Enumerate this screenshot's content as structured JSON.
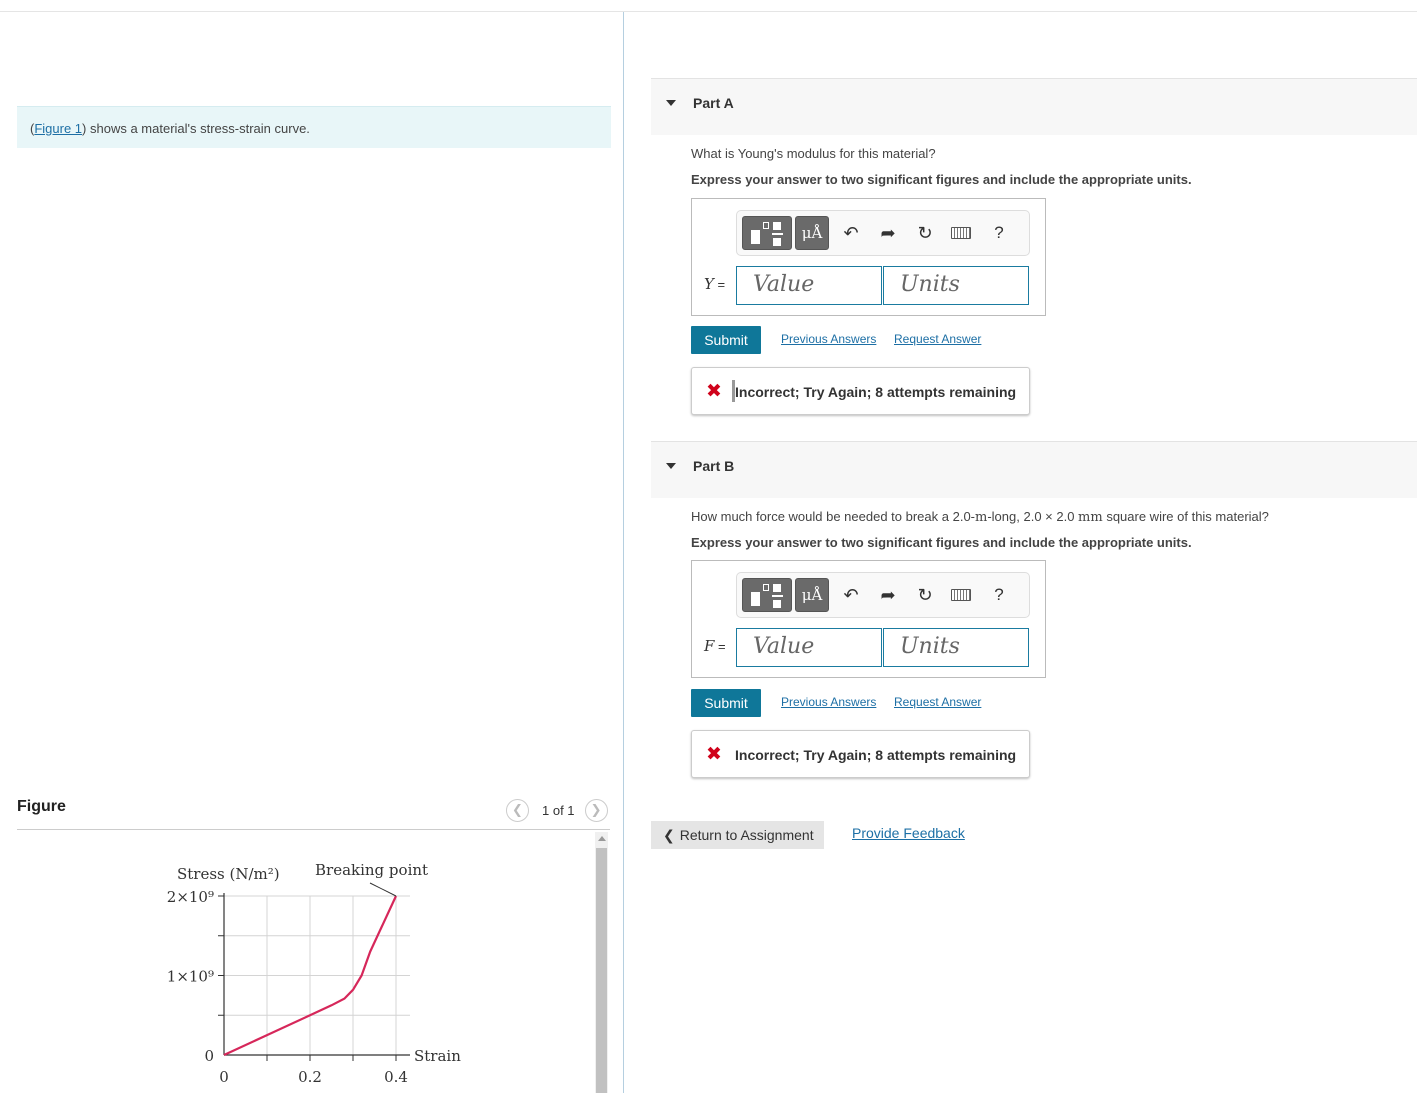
{
  "intro": {
    "paren_open": "(",
    "figure_link": "Figure 1",
    "text": ") shows a material's stress-strain curve."
  },
  "figure": {
    "title": "Figure",
    "pager_text": "1 of 1",
    "prev_icon": "chevron-left-icon",
    "next_icon": "chevron-right-icon"
  },
  "chart_data": {
    "type": "line",
    "title": "",
    "xlabel": "Strain",
    "ylabel": "Stress (N/m²)",
    "annotation": "Breaking point",
    "x_ticks": [
      "0",
      "0.2",
      "0.4"
    ],
    "y_ticks": [
      "0",
      "1×10⁹",
      "2×10⁹"
    ],
    "xlim": [
      0,
      0.4
    ],
    "ylim": [
      0,
      2000000000
    ],
    "grid": true,
    "series": [
      {
        "color": "#d6275a",
        "x": [
          0,
          0.1,
          0.2,
          0.25,
          0.28,
          0.3,
          0.32,
          0.34,
          0.37,
          0.4
        ],
        "y": [
          0,
          250000000,
          500000000,
          625000000,
          710000000,
          820000000,
          1000000000,
          1300000000,
          1650000000,
          2000000000
        ]
      }
    ]
  },
  "partA": {
    "title": "Part A",
    "question": "What is Young's modulus for this material?",
    "instruction": "Express your answer to two significant figures and include the appropriate units.",
    "variable": "Y",
    "equals": " =",
    "value_placeholder": "Value",
    "units_placeholder": "Units",
    "submit": "Submit",
    "previous_answers": "Previous Answers",
    "request_answer": "Request Answer",
    "feedback": "Incorrect; Try Again; 8 attempts remaining"
  },
  "partB": {
    "title": "Part B",
    "question_pre": "How much force would be needed to break a 2.0-",
    "question_unit1": "m",
    "question_mid": "-long, 2.0 × 2.0 ",
    "question_unit2": "mm",
    "question_post": " square wire of this material?",
    "instruction": "Express your answer to two significant figures and include the appropriate units.",
    "variable": "F",
    "equals": " =",
    "value_placeholder": "Value",
    "units_placeholder": "Units",
    "submit": "Submit",
    "previous_answers": "Previous Answers",
    "request_answer": "Request Answer",
    "feedback": "Incorrect; Try Again; 8 attempts remaining"
  },
  "toolbar": {
    "units_label": "μÅ",
    "help_label": "?"
  },
  "footer": {
    "return_label": "Return to Assignment",
    "provide_feedback": "Provide Feedback"
  },
  "colors": {
    "accent": "#0f7799",
    "link": "#1d6fa5",
    "error": "#d0021b",
    "curve": "#d6275a"
  }
}
